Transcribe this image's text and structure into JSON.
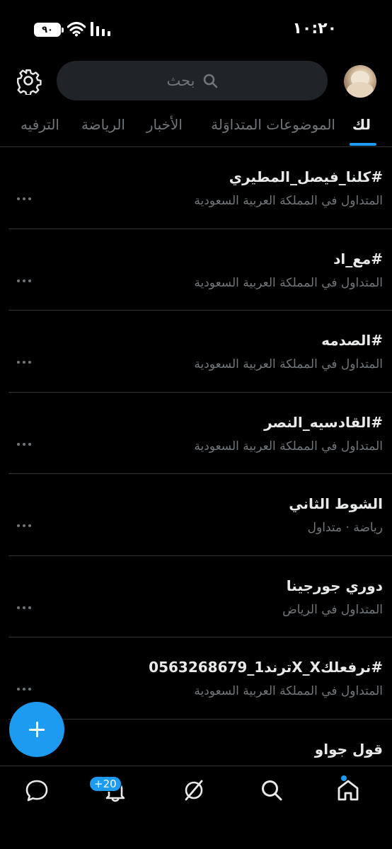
{
  "status_bar": {
    "time": "١٠:٢٠",
    "battery": "٩٠"
  },
  "header": {
    "search_placeholder": "بحث"
  },
  "tabs": [
    {
      "label": "لك",
      "active": true
    },
    {
      "label": "الموضوعات المتداوَلة",
      "active": false
    },
    {
      "label": "الأخبار",
      "active": false
    },
    {
      "label": "الرياضة",
      "active": false
    },
    {
      "label": "الترفيه",
      "active": false
    }
  ],
  "trends": [
    {
      "title": "#كلنا_فيصل_المطيري",
      "meta": "المتداول في المملكة العربية السعودية"
    },
    {
      "title": "#مع_اد",
      "meta": "المتداول في المملكة العربية السعودية"
    },
    {
      "title": "#الصدمه",
      "meta": "المتداول في المملكة العربية السعودية"
    },
    {
      "title": "#القادسيه_النصر",
      "meta": "المتداول في المملكة العربية السعودية"
    },
    {
      "title": "الشوط الثاني",
      "meta": "رياضة · متداول"
    },
    {
      "title": "دوري جورجينا",
      "meta": "المتداول في الرياض"
    },
    {
      "title": "#نرفعلكX_Xترند1_0563268679",
      "meta": "المتداول في المملكة العربية السعودية"
    },
    {
      "title": "قول جواو",
      "meta": ""
    }
  ],
  "bottom_nav": {
    "notification_count": "+20",
    "items": [
      "messages-icon",
      "notifications-icon",
      "grok-icon",
      "search-icon",
      "home-icon"
    ]
  },
  "colors": {
    "accent": "#1d9bf0",
    "background": "#000000",
    "muted_text": "#71767b",
    "divider": "#2f3336"
  }
}
